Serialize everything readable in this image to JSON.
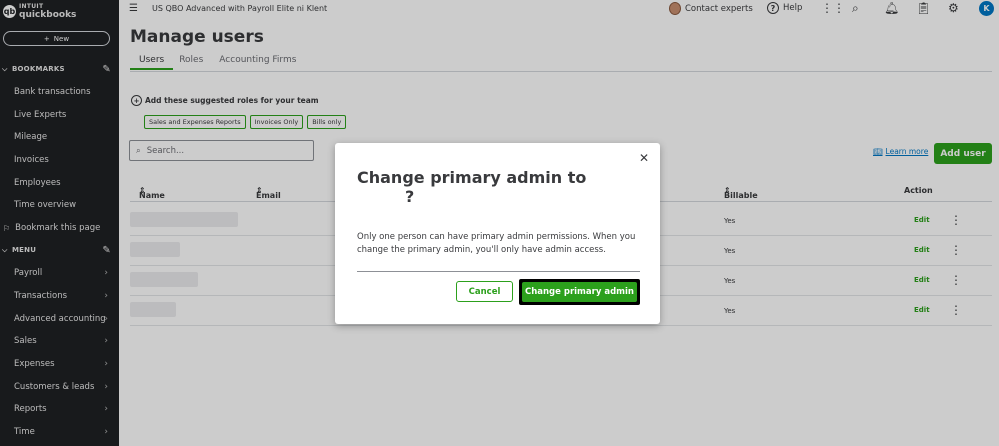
{
  "sidebar": {
    "logo_small": "INTUIT",
    "logo_big": "quickbooks",
    "new_label": "New",
    "bookmarks_header": "BOOKMARKS",
    "bookmarks": [
      "Bank transactions",
      "Live Experts",
      "Mileage",
      "Invoices",
      "Employees",
      "Time overview"
    ],
    "bookmark_page": "Bookmark this page",
    "menu_header": "MENU",
    "menu": [
      "Payroll",
      "Transactions",
      "Advanced accounting",
      "Sales",
      "Expenses",
      "Customers & leads",
      "Reports",
      "Time"
    ]
  },
  "topbar": {
    "company": "US QBO Advanced with Payroll Elite ni Klent",
    "contact": "Contact experts",
    "help": "Help",
    "user_initial": "K"
  },
  "page": {
    "title": "Manage users",
    "tabs": [
      "Users",
      "Roles",
      "Accounting Firms"
    ],
    "suggest_label": "Add these suggested roles for your team",
    "chips": [
      "Sales and Expenses Reports",
      "Invoices Only",
      "Bills only"
    ],
    "search_placeholder": "Search...",
    "learn_more": "Learn more",
    "add_user": "Add user"
  },
  "table": {
    "headers": {
      "name": "Name",
      "email": "Email",
      "billable": "Billable",
      "action": "Action"
    },
    "rows": [
      {
        "billable": "Yes",
        "action": "Edit"
      },
      {
        "billable": "Yes",
        "action": "Edit"
      },
      {
        "billable": "Yes",
        "action": "Edit"
      },
      {
        "billable": "Yes",
        "action": "Edit"
      }
    ]
  },
  "modal": {
    "title": "Change primary admin to",
    "title_q": "?",
    "body": "Only one person can have primary admin permissions. When you change the primary admin, you'll only have admin access.",
    "cancel": "Cancel",
    "confirm": "Change primary admin"
  },
  "colors": {
    "accent": "#2ca01c",
    "sidebar": "#1f2124",
    "link": "#0077c5"
  }
}
